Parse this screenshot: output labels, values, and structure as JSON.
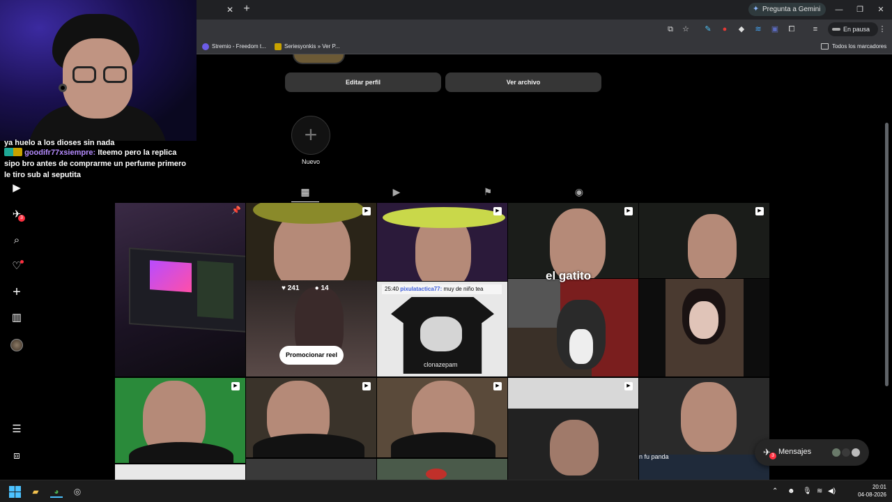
{
  "browser": {
    "gemini_button": "Pregunta a Gemini",
    "profile_status": "En pausa",
    "bookmarks": [
      {
        "label": "Stremio - Freedom t...",
        "color": "#6c5ce7"
      },
      {
        "label": "Seriesyonkis » Ver P...",
        "color": "#c8a200"
      }
    ],
    "bookmarks_all": "Todos los marcadores"
  },
  "stream_chat": {
    "line1": "ya huelo a los dioses sin nada",
    "username": "goodifr77xsiempre:",
    "message": " Iteemo pero la replica sipo bro antes de comprarme un perfume primero le tiro sub al seputita"
  },
  "sidebar": {
    "notifications_badge": "3"
  },
  "profile": {
    "edit_button": "Editar perfil",
    "archive_button": "Ver archivo",
    "highlight_new_label": "Nuevo"
  },
  "post_overlay": {
    "likes": "241",
    "comments": "14",
    "promote_button": "Promocionar reel"
  },
  "chat_popup": {
    "time": "25:40",
    "user": "pixulatactica77:",
    "text": " muy de niño tea"
  },
  "captions": {
    "shirt": "clonazepam",
    "gatito": "el gatito",
    "panda": "n fu panda"
  },
  "messages": {
    "label": "Mensajes",
    "badge": "3"
  },
  "taskbar": {
    "time": "20:01",
    "date": "04-08-2026"
  },
  "colors": {
    "accent_red": "#ff3040",
    "ig_button": "#363636",
    "chrome_dark": "#202124"
  }
}
